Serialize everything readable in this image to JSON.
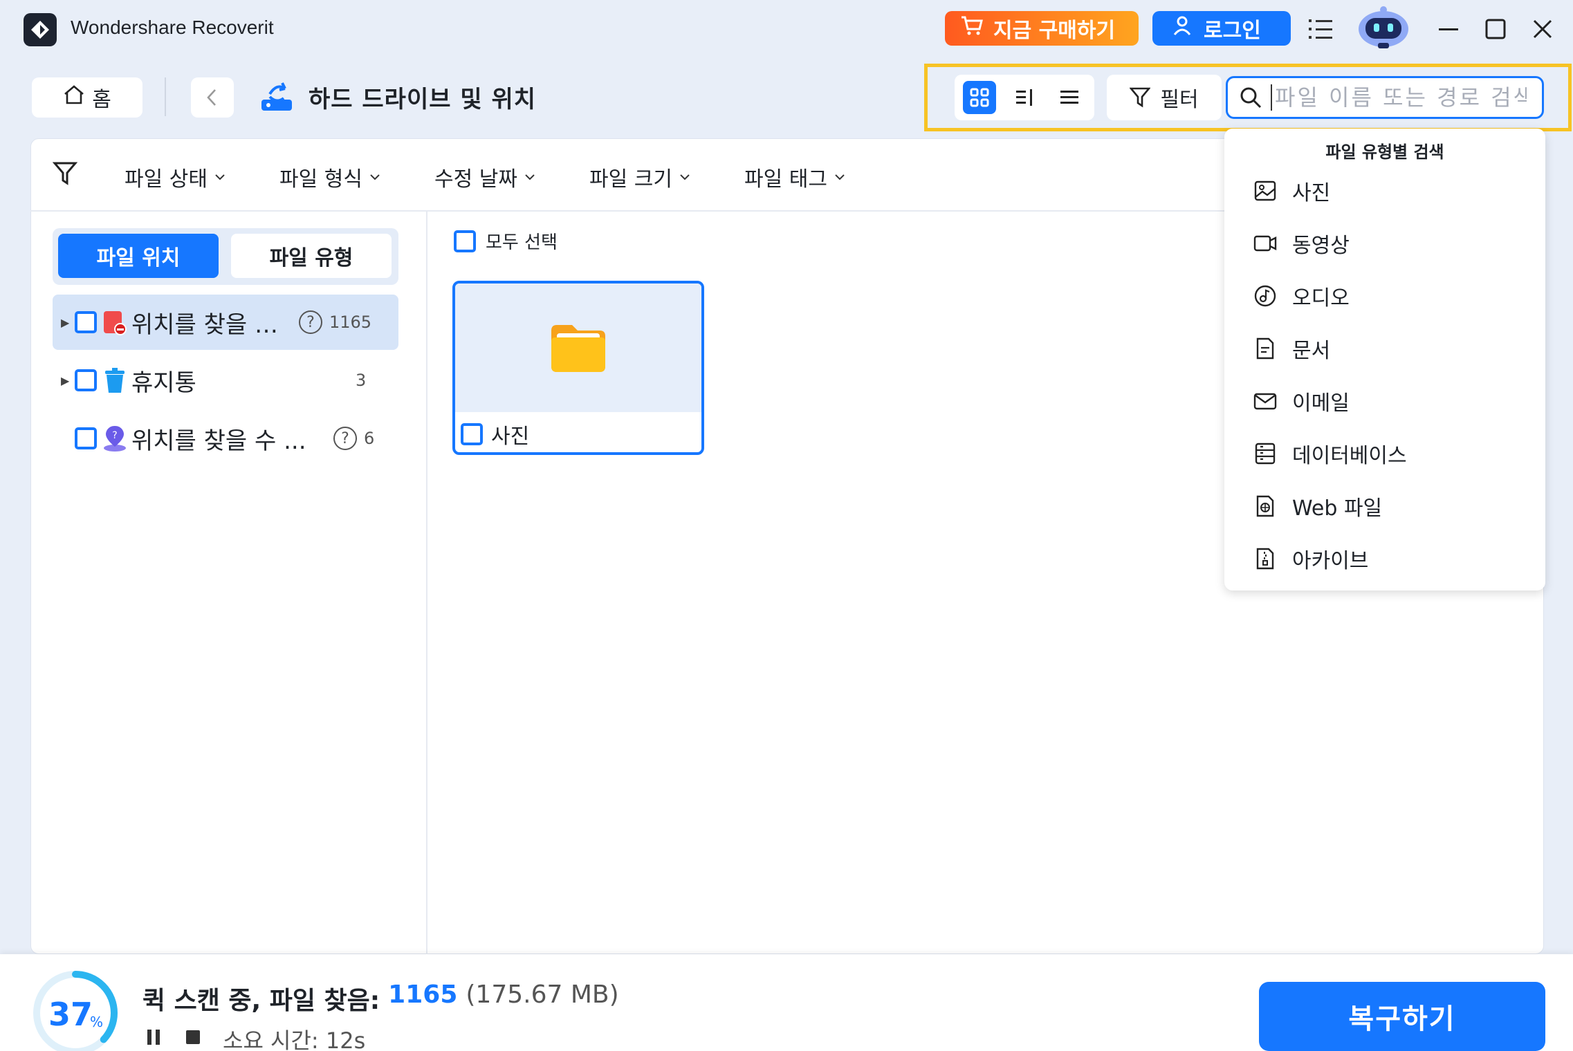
{
  "app": {
    "title": "Wondershare Recoverit"
  },
  "header": {
    "buy_label": "지금 구매하기",
    "login_label": "로그인"
  },
  "nav": {
    "home_label": "홈",
    "location_title": "하드 드라이브 및 위치"
  },
  "toolbar": {
    "filter_label": "필터",
    "search_placeholder": "파일 이름 또는 경로 검색"
  },
  "filter_bar": {
    "items": [
      "파일 상태",
      "파일 형식",
      "수정 날짜",
      "파일 크기",
      "파일 태그"
    ]
  },
  "left_tabs": {
    "active": "파일 위치",
    "inactive": "파일 유형"
  },
  "tree": [
    {
      "label": "위치를 찾을 수...",
      "count": "1165",
      "help": true
    },
    {
      "label": "휴지통",
      "count": "3",
      "help": false
    },
    {
      "label": "위치를 찾을 수 ...",
      "count": "6",
      "help": true
    }
  ],
  "content": {
    "select_all": "모두 선택",
    "folder_label": "사진"
  },
  "dropdown": {
    "title": "파일 유형별 검색",
    "items": [
      {
        "label": "사진",
        "icon": "image-icon"
      },
      {
        "label": "동영상",
        "icon": "video-icon"
      },
      {
        "label": "오디오",
        "icon": "audio-icon"
      },
      {
        "label": "문서",
        "icon": "document-icon"
      },
      {
        "label": "이메일",
        "icon": "email-icon"
      },
      {
        "label": "데이터베이스",
        "icon": "database-icon"
      },
      {
        "label": "Web 파일",
        "icon": "web-file-icon"
      },
      {
        "label": "아카이브",
        "icon": "archive-icon"
      }
    ]
  },
  "status": {
    "progress_value": "37",
    "progress_unit": "%",
    "scan_prefix": "퀵 스캔 중, 파일 찾음:",
    "scan_count": "1165",
    "scan_size": "(175.67 MB)",
    "elapsed": "소요 시간: 12s",
    "recover_label": "복구하기"
  },
  "colors": {
    "accent": "#1677ff",
    "highlight": "#f7c325",
    "buy_gradient_start": "#ff5a1f",
    "buy_gradient_end": "#ffa51f"
  }
}
